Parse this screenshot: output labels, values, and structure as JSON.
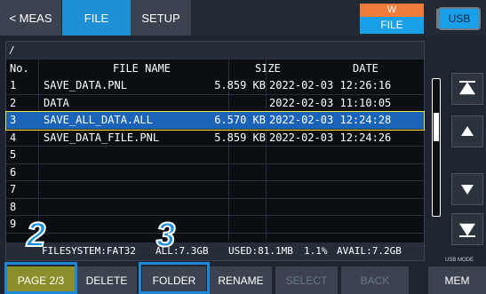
{
  "tabs": {
    "meas": "< MEAS",
    "file": "FILE",
    "setup": "SETUP"
  },
  "indicator": {
    "top": "W",
    "bottom": "FILE"
  },
  "usb_label": "USB",
  "path": "/",
  "columns": {
    "no": "No.",
    "name": "FILE NAME",
    "size": "SIZE",
    "date": "DATE"
  },
  "rows": [
    {
      "no": "1",
      "name": "SAVE_DATA.PNL",
      "size": "5.859 KB",
      "date": "2022-02-03 12:26:16"
    },
    {
      "no": "2",
      "name": "DATA",
      "size": "",
      "date": "2022-02-03 11:10:05"
    },
    {
      "no": "3",
      "name": "SAVE_ALL_DATA.ALL",
      "size": "6.570 KB",
      "date": "2022-02-03 12:24:28"
    },
    {
      "no": "4",
      "name": "SAVE_DATA_FILE.PNL",
      "size": "5.859 KB",
      "date": "2022-02-03 12:24:26"
    },
    {
      "no": "5",
      "name": "",
      "size": "",
      "date": ""
    },
    {
      "no": "6",
      "name": "",
      "size": "",
      "date": ""
    },
    {
      "no": "7",
      "name": "",
      "size": "",
      "date": ""
    },
    {
      "no": "8",
      "name": "",
      "size": "",
      "date": ""
    },
    {
      "no": "9",
      "name": "",
      "size": "",
      "date": ""
    }
  ],
  "selected_row": 3,
  "status": {
    "fs": "FILESYSTEM:FAT32",
    "all": "ALL:7.3GB",
    "used": "USED:81.1MB",
    "pct": "1.1%",
    "avail": "AVAIL:7.2GB"
  },
  "usb_mode": "USB MODE",
  "buttons": {
    "page": "PAGE 2/3",
    "delete": "DELETE",
    "folder": "FOLDER",
    "rename": "RENAME",
    "select": "SELECT",
    "back": "BACK",
    "mem": "MEM"
  },
  "callouts": {
    "two": "2",
    "three": "3"
  },
  "colors": {
    "accent": "#1f8fd8",
    "selection": "#1a63b8",
    "highlight": "#1e88d8",
    "page_button": "#8a8f2c"
  }
}
